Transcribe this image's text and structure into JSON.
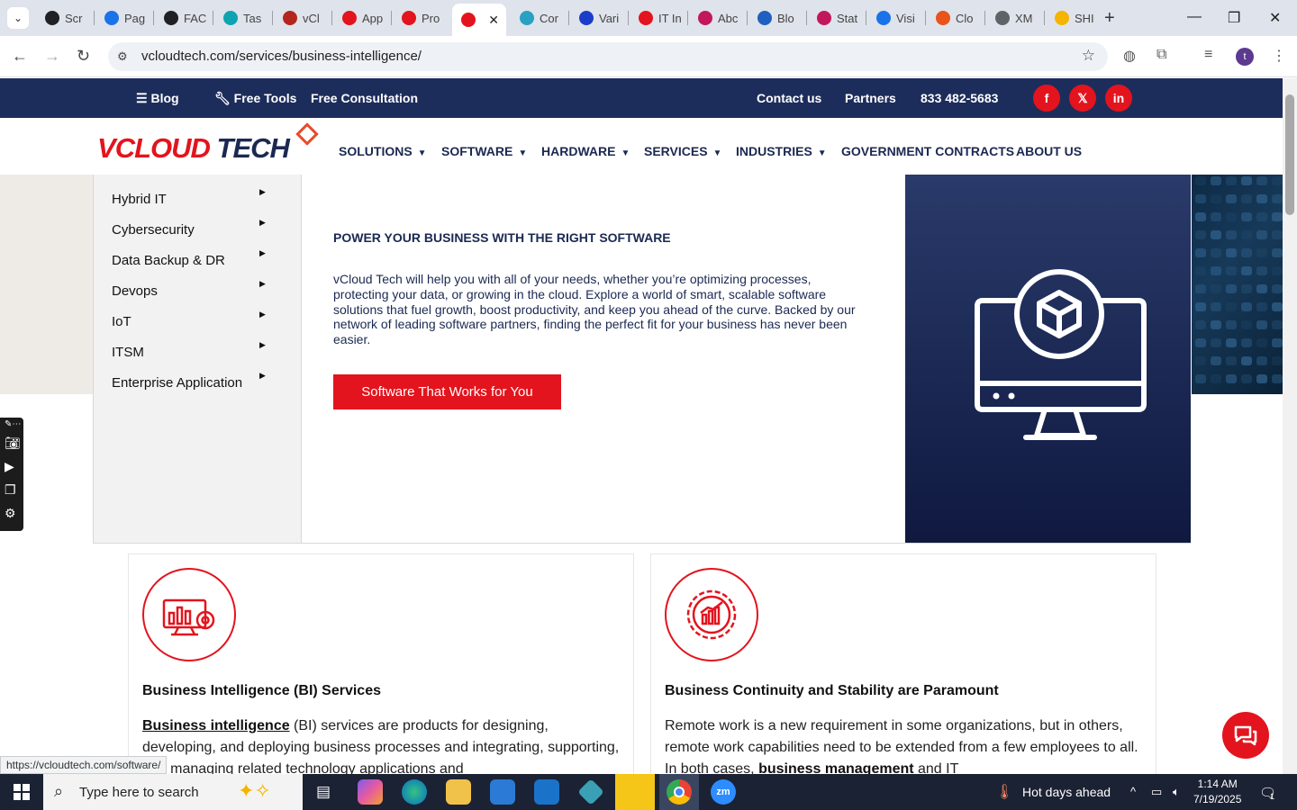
{
  "browser": {
    "tabs": [
      {
        "label": "Scr",
        "color": "#202124"
      },
      {
        "label": "Pag",
        "color": "#1a73e8"
      },
      {
        "label": "FAC",
        "color": "#202124"
      },
      {
        "label": "Tas",
        "color": "#0fa3b1"
      },
      {
        "label": "vCl",
        "color": "#b3261e"
      },
      {
        "label": "App",
        "color": "#e3141d"
      },
      {
        "label": "Pro",
        "color": "#e3141d"
      },
      {
        "label": "",
        "color": "#e3141d",
        "active": true
      },
      {
        "label": "Cor",
        "color": "#2aa1c0"
      },
      {
        "label": "Vari",
        "color": "#1a3ec9"
      },
      {
        "label": "IT In",
        "color": "#e3141d"
      },
      {
        "label": "Abc",
        "color": "#c2185b"
      },
      {
        "label": "Blo",
        "color": "#1f5fbf"
      },
      {
        "label": "Stat",
        "color": "#c2185b"
      },
      {
        "label": "Visi",
        "color": "#1a73e8"
      },
      {
        "label": "Clo",
        "color": "#e8541a"
      },
      {
        "label": "XM",
        "color": "#5f6368"
      },
      {
        "label": "SHI",
        "color": "#f4b400"
      }
    ],
    "url": "vcloudtech.com/services/business-intelligence/",
    "profile_initial": "t",
    "status_url": "https://vcloudtech.com/software/"
  },
  "topbar": {
    "blog": "Blog",
    "free_tools": "Free Tools",
    "free_consultation": "Free Consultation",
    "contact": "Contact us",
    "partners": "Partners",
    "phone": "833 482-5683",
    "social": [
      "f",
      "𝕏",
      "in"
    ]
  },
  "logo": {
    "v": "V",
    "cloud": "CLOUD",
    "tech": "TECH"
  },
  "nav": [
    {
      "label": "SOLUTIONS",
      "dropdown": true
    },
    {
      "label": "SOFTWARE",
      "dropdown": true
    },
    {
      "label": "HARDWARE",
      "dropdown": true
    },
    {
      "label": "SERVICES",
      "dropdown": true
    },
    {
      "label": "INDUSTRIES",
      "dropdown": true
    },
    {
      "label": "GOVERNMENT CONTRACTS",
      "dropdown": false
    },
    {
      "label": "ABOUT US",
      "dropdown": false
    }
  ],
  "side_menu": [
    "Hybrid IT",
    "Cybersecurity",
    "Data Backup & DR",
    "Devops",
    "IoT",
    "ITSM",
    "Enterprise Application"
  ],
  "hero": {
    "heading": "POWER YOUR BUSINESS WITH THE RIGHT SOFTWARE",
    "text": "vCloud Tech will help you with all of your needs, whether you’re optimizing processes, protecting your data, or growing in the cloud. Explore a world of smart, scalable software solutions that fuel growth, boost productivity, and keep you ahead of the curve. Backed by our network of leading software partners, finding the perfect fit for your business has never been easier.",
    "button": "Software That Works for You"
  },
  "cards": [
    {
      "title": "Business Intelligence (BI) Services",
      "link": "Business intelligence",
      "body_rest": " (BI) services are products for designing, developing, and deploying business processes and integrating, supporting, and managing related technology applications and"
    },
    {
      "title": "Business Continuity and Stability are Paramount",
      "body_start": "Remote work is a new requirement in some organizations, but in others, remote work capabilities need to be extended from a few employees to all. In both cases, ",
      "link": "business management",
      "body_end": " and IT"
    }
  ],
  "taskbar": {
    "search_placeholder": "Type here to search",
    "weather": "Hot days ahead",
    "time": "1:14 AM",
    "date": "7/19/2025",
    "notification_count": "1"
  },
  "colors": {
    "brand_red": "#e3141d",
    "brand_navy": "#1b2952",
    "topbar": "#1d2d5b"
  }
}
